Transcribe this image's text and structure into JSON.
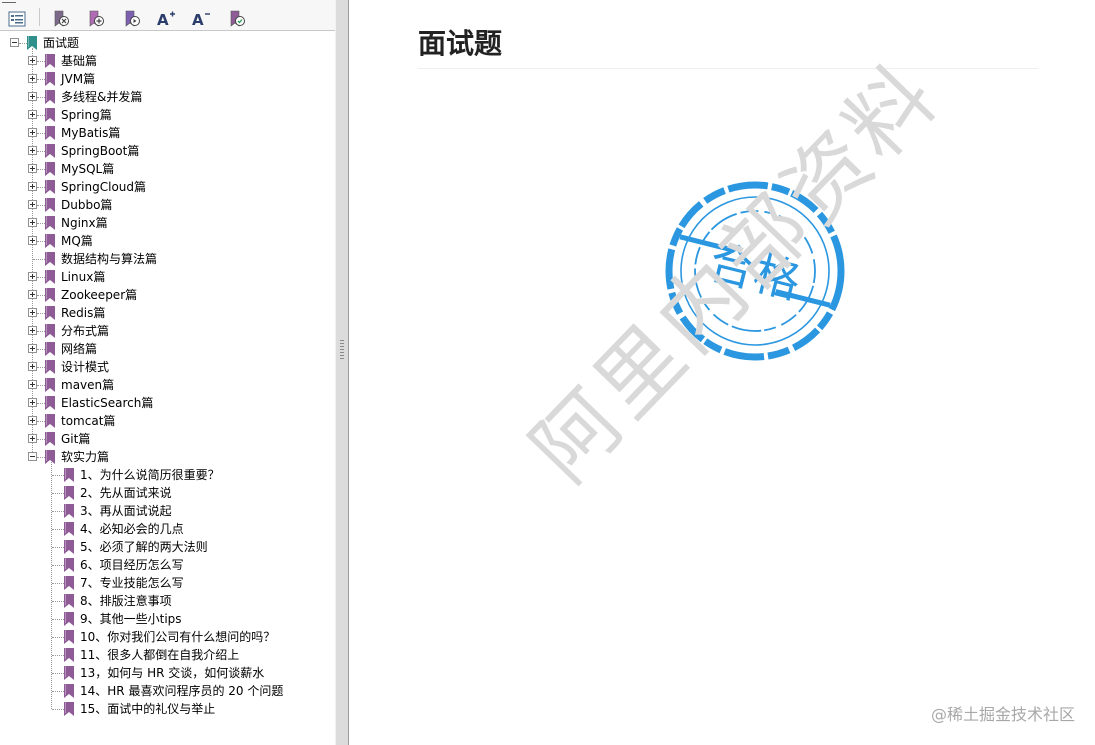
{
  "toolbar": {
    "buttons": [
      {
        "name": "outline-view-icon"
      },
      {
        "name": "bookmark-remove-icon"
      },
      {
        "name": "bookmark-add-icon"
      },
      {
        "name": "bookmark-goto-icon"
      },
      {
        "name": "font-increase-icon",
        "label": "A+"
      },
      {
        "name": "font-decrease-icon",
        "label": "A-"
      },
      {
        "name": "bookmark-properties-icon"
      }
    ]
  },
  "tree": {
    "root": "面试题",
    "items": [
      {
        "label": "基础篇",
        "expand": "plus"
      },
      {
        "label": "JVM篇",
        "expand": "plus"
      },
      {
        "label": "多线程&并发篇",
        "expand": "plus"
      },
      {
        "label": "Spring篇",
        "expand": "plus"
      },
      {
        "label": "MyBatis篇",
        "expand": "plus"
      },
      {
        "label": "SpringBoot篇",
        "expand": "plus"
      },
      {
        "label": "MySQL篇",
        "expand": "plus"
      },
      {
        "label": "SpringCloud篇",
        "expand": "plus"
      },
      {
        "label": "Dubbo篇",
        "expand": "plus"
      },
      {
        "label": "Nginx篇",
        "expand": "plus"
      },
      {
        "label": "MQ篇",
        "expand": "plus"
      },
      {
        "label": "数据结构与算法篇",
        "expand": "none"
      },
      {
        "label": "Linux篇",
        "expand": "plus"
      },
      {
        "label": "Zookeeper篇",
        "expand": "plus"
      },
      {
        "label": "Redis篇",
        "expand": "plus"
      },
      {
        "label": "分布式篇",
        "expand": "plus"
      },
      {
        "label": "网络篇",
        "expand": "plus"
      },
      {
        "label": "设计模式",
        "expand": "plus"
      },
      {
        "label": "maven篇",
        "expand": "plus"
      },
      {
        "label": "ElasticSearch篇",
        "expand": "plus"
      },
      {
        "label": "tomcat篇",
        "expand": "plus"
      },
      {
        "label": "Git篇",
        "expand": "plus"
      },
      {
        "label": "软实力篇",
        "expand": "minus"
      }
    ],
    "children": [
      "1、为什么说简历很重要？",
      "2、先从面试来说",
      "3、再从面试说起",
      "4、必知必会的几点",
      "5、必须了解的两大法则",
      "6、项目经历怎么写",
      "7、专业技能怎么写",
      "8、排版注意事项",
      "9、其他一些小tips",
      "10、你对我们公司有什么想问的吗？",
      "11、很多人都倒在自我介绍上",
      "13，如何与 HR 交谈，如何谈薪水",
      "14、HR 最喜欢问程序员的 20 个问题",
      "15、面试中的礼仪与举止"
    ]
  },
  "document": {
    "title": "面试题",
    "stamp_text": "合格",
    "watermark": "阿里内部资料",
    "credit": "@稀土掘金技术社区"
  },
  "colors": {
    "bookmark": "#8e5b96",
    "root_bookmark": "#2f8f8a",
    "stamp": "#2b97e0",
    "watermark": "#d9d9d9"
  }
}
